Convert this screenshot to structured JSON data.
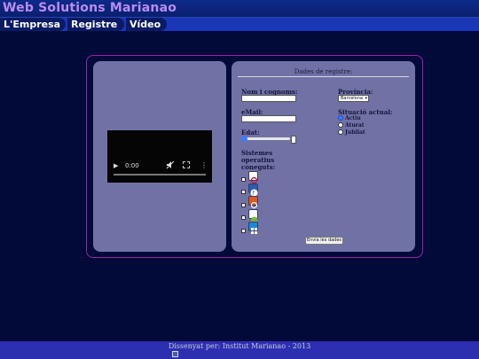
{
  "header": {
    "brand": "Web Solutions Marianao"
  },
  "nav": {
    "items": [
      {
        "label": "L'Empresa"
      },
      {
        "label": "Registre"
      },
      {
        "label": "Vídeo"
      }
    ]
  },
  "video": {
    "time": "0:00",
    "progress": 0
  },
  "form": {
    "legend": "Dades de registre:",
    "name_label": "Nom i cognoms:",
    "name_value": "",
    "email_label": "eMail:",
    "email_value": "",
    "age_label": "Edat:",
    "age_slider_fraction": 0.0,
    "os_label": "Sistemes operatius coneguts:",
    "os_icons": [
      {
        "icon": "debian-icon",
        "checked": false
      },
      {
        "icon": "fedora-icon",
        "checked": false
      },
      {
        "icon": "ubuntu-icon",
        "checked": false
      },
      {
        "icon": "android-icon",
        "checked": false
      },
      {
        "icon": "windows-icon",
        "checked": false
      }
    ],
    "province_label": "Província:",
    "province_selected": "Barcelona",
    "status_label": "Situació actual:",
    "status_options": [
      {
        "label": "Actiu",
        "selected": true
      },
      {
        "label": "Aturat",
        "selected": false
      },
      {
        "label": "Jubilat",
        "selected": false
      }
    ],
    "submit_label": "Envia les dades"
  },
  "footer": {
    "text": "Dissenyat per: Institut Marianao - 2013"
  },
  "colors": {
    "background": "#020a3a",
    "panel": "#7072a5",
    "frame": "#a01fa8",
    "nav": "#1a37b8",
    "brand": "#b98cf0"
  }
}
